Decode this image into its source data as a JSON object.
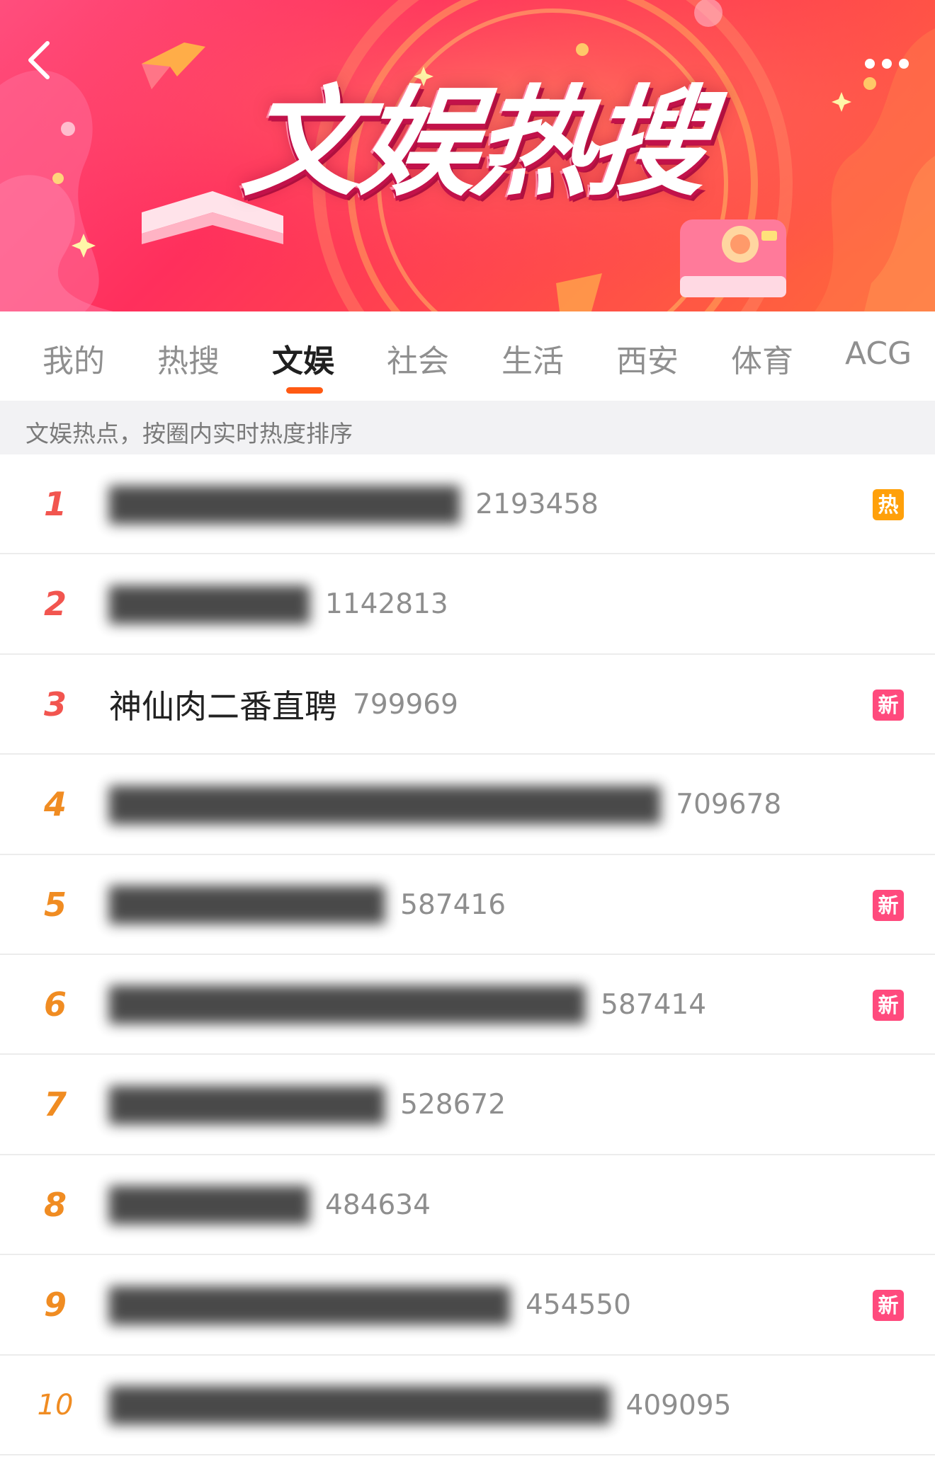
{
  "header": {
    "title": "文娱热搜",
    "back_icon": "chevron-left-icon",
    "more_icon": "more-dots-icon"
  },
  "tabs": [
    {
      "label": "我的",
      "active": false
    },
    {
      "label": "热搜",
      "active": false
    },
    {
      "label": "文娱",
      "active": true
    },
    {
      "label": "社会",
      "active": false
    },
    {
      "label": "生活",
      "active": false
    },
    {
      "label": "西安",
      "active": false
    },
    {
      "label": "体育",
      "active": false
    },
    {
      "label": "ACG",
      "active": false
    }
  ],
  "subtitle": "文娱热点，按圈内实时热度排序",
  "list": [
    {
      "rank": "1",
      "topic": "██████████████",
      "topic_blurred": true,
      "count": "2193458",
      "badge": "热"
    },
    {
      "rank": "2",
      "topic": "████████",
      "topic_blurred": true,
      "count": "1142813",
      "badge": ""
    },
    {
      "rank": "3",
      "topic": "神仙肉二番直聘",
      "topic_blurred": false,
      "count": "799969",
      "badge": "新"
    },
    {
      "rank": "4",
      "topic": "██████████████████████",
      "topic_blurred": true,
      "count": "709678",
      "badge": ""
    },
    {
      "rank": "5",
      "topic": "███████████",
      "topic_blurred": true,
      "count": "587416",
      "badge": "新"
    },
    {
      "rank": "6",
      "topic": "███████████████████",
      "topic_blurred": true,
      "count": "587414",
      "badge": "新"
    },
    {
      "rank": "7",
      "topic": "███████████",
      "topic_blurred": true,
      "count": "528672",
      "badge": ""
    },
    {
      "rank": "8",
      "topic": "████████",
      "topic_blurred": true,
      "count": "484634",
      "badge": ""
    },
    {
      "rank": "9",
      "topic": "████████████████",
      "topic_blurred": true,
      "count": "454550",
      "badge": "新"
    },
    {
      "rank": "10",
      "topic": "████████████████████",
      "topic_blurred": true,
      "count": "409095",
      "badge": ""
    }
  ],
  "colors": {
    "accent": "#ff5a13",
    "rank_top": "#f2554f",
    "rank_other": "#f08c22",
    "badge_hot": "#ffa00a",
    "badge_new": "#ff4a7d",
    "banner_base": "#ff3a5e"
  }
}
